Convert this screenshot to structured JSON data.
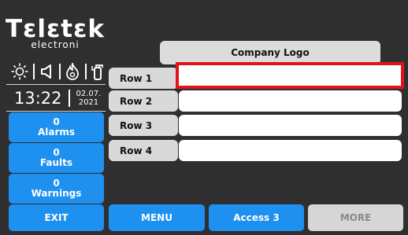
{
  "brand": {
    "name": "Tεlεtεk",
    "sub": "electroni"
  },
  "status_icons": [
    "sun-icon",
    "speaker-icon",
    "fire-icon",
    "extinguisher-icon"
  ],
  "clock": {
    "time": "13:22",
    "date_line1": "02.07.",
    "date_line2": "2021"
  },
  "stats": [
    {
      "count": "0",
      "label": "Alarms"
    },
    {
      "count": "0",
      "label": "Faults"
    },
    {
      "count": "0",
      "label": "Warnings"
    }
  ],
  "logo_label": "Company Logo",
  "rows": [
    {
      "label": "Row 1",
      "value": ""
    },
    {
      "label": "Row 2",
      "value": ""
    },
    {
      "label": "Row 3",
      "value": ""
    },
    {
      "label": "Row 4",
      "value": ""
    }
  ],
  "bottom": {
    "exit": "EXIT",
    "menu": "MENU",
    "access": "Access 3",
    "more": "MORE"
  },
  "colors": {
    "accent": "#1e90ef",
    "selection": "#e3131b",
    "background": "#2f2f2f"
  }
}
